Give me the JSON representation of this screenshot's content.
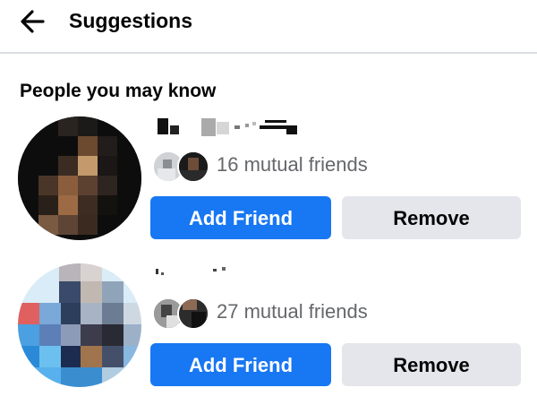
{
  "header": {
    "title": "Suggestions",
    "back_icon": "arrow-left-icon"
  },
  "section": {
    "heading": "People you may know"
  },
  "suggestions": [
    {
      "mutual_friends": "16 mutual friends",
      "add_label": "Add Friend",
      "remove_label": "Remove"
    },
    {
      "mutual_friends": "27 mutual friends",
      "add_label": "Add Friend",
      "remove_label": "Remove"
    }
  ],
  "colors": {
    "primary": "#1877f2",
    "secondary_bg": "#e4e6eb",
    "muted_text": "#65676b",
    "divider": "#dadde1"
  }
}
